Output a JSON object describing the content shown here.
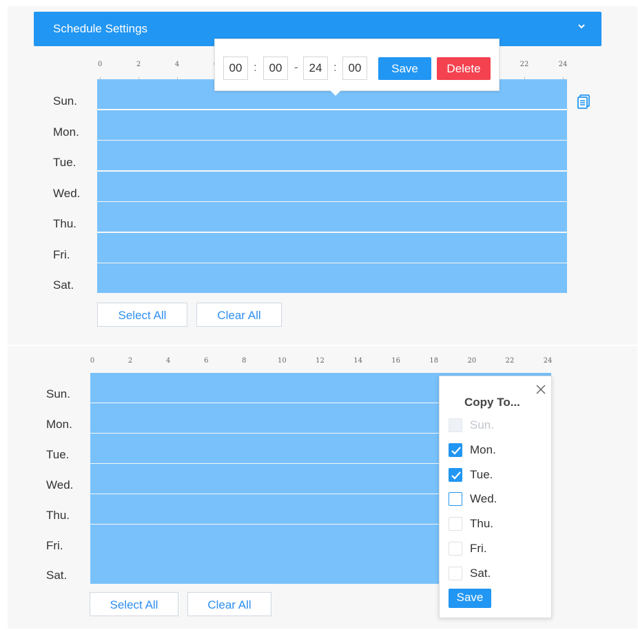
{
  "header": {
    "title": "Schedule Settings",
    "icon": "chevron-down-icon"
  },
  "timeline": {
    "tick_labels": [
      "0",
      "2",
      "4",
      "6",
      "8",
      "10",
      "12",
      "14",
      "16",
      "18",
      "20",
      "22",
      "24"
    ]
  },
  "days": [
    "Sun.",
    "Mon.",
    "Tue.",
    "Wed.",
    "Thu.",
    "Fri.",
    "Sat."
  ],
  "colors": {
    "accent": "#2196f3",
    "schedule_fill": "#79c1fb",
    "delete": "#f44250"
  },
  "time_popup": {
    "start_hour": "00",
    "start_minute": "00",
    "end_hour": "24",
    "end_minute": "00",
    "colon": ":",
    "dash": "-",
    "save_label": "Save",
    "delete_label": "Delete"
  },
  "buttons": {
    "select_all": "Select All",
    "clear_all": "Clear All"
  },
  "copy_to": {
    "title": "Copy To...",
    "items": [
      {
        "label": "Sun.",
        "state": "disabled"
      },
      {
        "label": "Mon.",
        "state": "checked"
      },
      {
        "label": "Tue.",
        "state": "checked"
      },
      {
        "label": "Wed.",
        "state": "focused"
      },
      {
        "label": "Thu.",
        "state": "unchecked"
      },
      {
        "label": "Fri.",
        "state": "unchecked"
      },
      {
        "label": "Sat.",
        "state": "unchecked"
      }
    ],
    "save_label": "Save"
  }
}
